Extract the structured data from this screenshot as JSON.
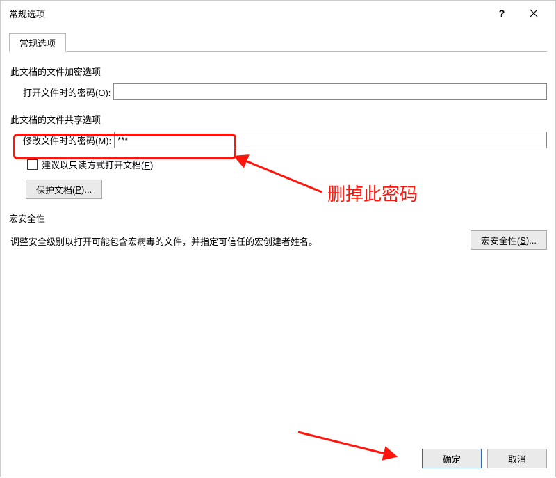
{
  "window": {
    "title": "常规选项",
    "help_label": "?",
    "close_label": "✕"
  },
  "tab": {
    "label": "常规选项"
  },
  "sections": {
    "encrypt": {
      "heading": "此文档的文件加密选项",
      "open_pw_label_pre": "打开文件时的密码(",
      "open_pw_key": "O",
      "open_pw_label_post": "):",
      "open_pw_value": ""
    },
    "share": {
      "heading": "此文档的文件共享选项",
      "mod_pw_label_pre": "修改文件时的密码(",
      "mod_pw_key": "M",
      "mod_pw_label_post": "):",
      "mod_pw_value": "***",
      "readonly_label_pre": "建议以只读方式打开文档(",
      "readonly_key": "E",
      "readonly_label_post": ")",
      "protect_btn_pre": "保护文档(",
      "protect_btn_key": "P",
      "protect_btn_post": ")..."
    },
    "macro": {
      "heading": "宏安全性",
      "text": "调整安全级别以打开可能包含宏病毒的文件，并指定可信任的宏创建者姓名。",
      "btn_pre": "宏安全性(",
      "btn_key": "S",
      "btn_post": ")..."
    }
  },
  "footer": {
    "ok": "确定",
    "cancel": "取消"
  },
  "annotation": {
    "callout": "删掉此密码"
  }
}
